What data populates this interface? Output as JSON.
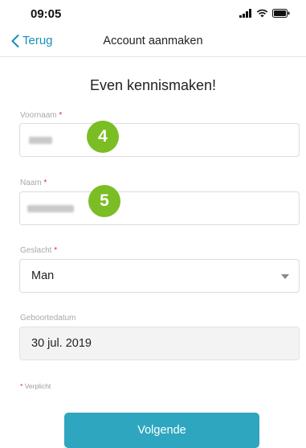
{
  "status_bar": {
    "time": "09:05",
    "icons": [
      "signal-icon",
      "wifi-icon",
      "battery-icon"
    ]
  },
  "nav": {
    "back_label": "Terug",
    "title": "Account aanmaken"
  },
  "heading": "Even kennismaken!",
  "required_marker": "*",
  "fields": {
    "first_name": {
      "label": "Voornaam",
      "badge": "4"
    },
    "last_name": {
      "label": "Naam",
      "badge": "5"
    },
    "gender": {
      "label": "Geslacht",
      "value": "Man"
    },
    "birthdate": {
      "label": "Geboortedatum",
      "value": "30 jul. 2019"
    }
  },
  "required_note": "Verplicht",
  "next_button_label": "Volgende",
  "colors": {
    "accent": "#2fa6bf",
    "back_link": "#1a8fb5",
    "badge": "#7bbd24",
    "required": "#d9302c"
  }
}
